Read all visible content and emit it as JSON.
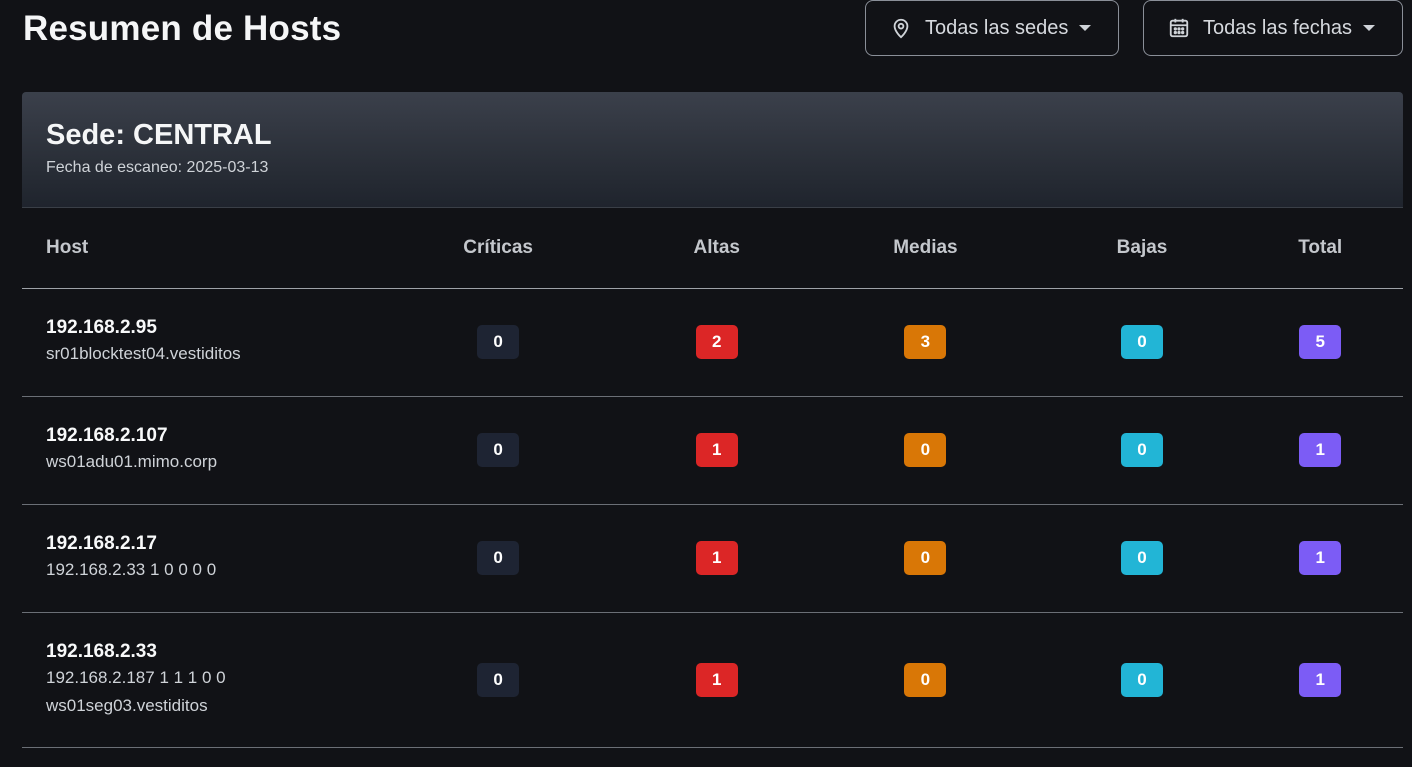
{
  "page": {
    "title": "Resumen de Hosts"
  },
  "filters": {
    "sede_label": "Todas las sedes",
    "fecha_label": "Todas las fechas"
  },
  "card": {
    "title": "Sede: CENTRAL",
    "scan_date": "Fecha de escaneo: 2025-03-13"
  },
  "table": {
    "columns": [
      "Host",
      "Críticas",
      "Altas",
      "Medias",
      "Bajas",
      "Total"
    ],
    "rows": [
      {
        "ip": "192.168.2.95",
        "lines": [
          "sr01blocktest04.vestiditos"
        ],
        "criticas": "0",
        "altas": "2",
        "medias": "3",
        "bajas": "0",
        "total": "5"
      },
      {
        "ip": "192.168.2.107",
        "lines": [
          "ws01adu01.mimo.corp"
        ],
        "criticas": "0",
        "altas": "1",
        "medias": "0",
        "bajas": "0",
        "total": "1"
      },
      {
        "ip": "192.168.2.17",
        "lines": [
          "192.168.2.33 1 0 0 0 0"
        ],
        "criticas": "0",
        "altas": "1",
        "medias": "0",
        "bajas": "0",
        "total": "1"
      },
      {
        "ip": "192.168.2.33",
        "lines": [
          "192.168.2.187 1 1 1 0 0",
          "ws01seg03.vestiditos"
        ],
        "criticas": "0",
        "altas": "1",
        "medias": "0",
        "bajas": "0",
        "total": "1"
      }
    ]
  },
  "colors": {
    "criticas": "#1e2433",
    "altas": "#dc2626",
    "medias": "#d97706",
    "bajas": "#22b5d6",
    "total": "#7c5cf5"
  },
  "icons": {
    "sede": "map-pin-icon",
    "fecha": "calendar-icon",
    "dropdown": "caret-down-icon"
  }
}
